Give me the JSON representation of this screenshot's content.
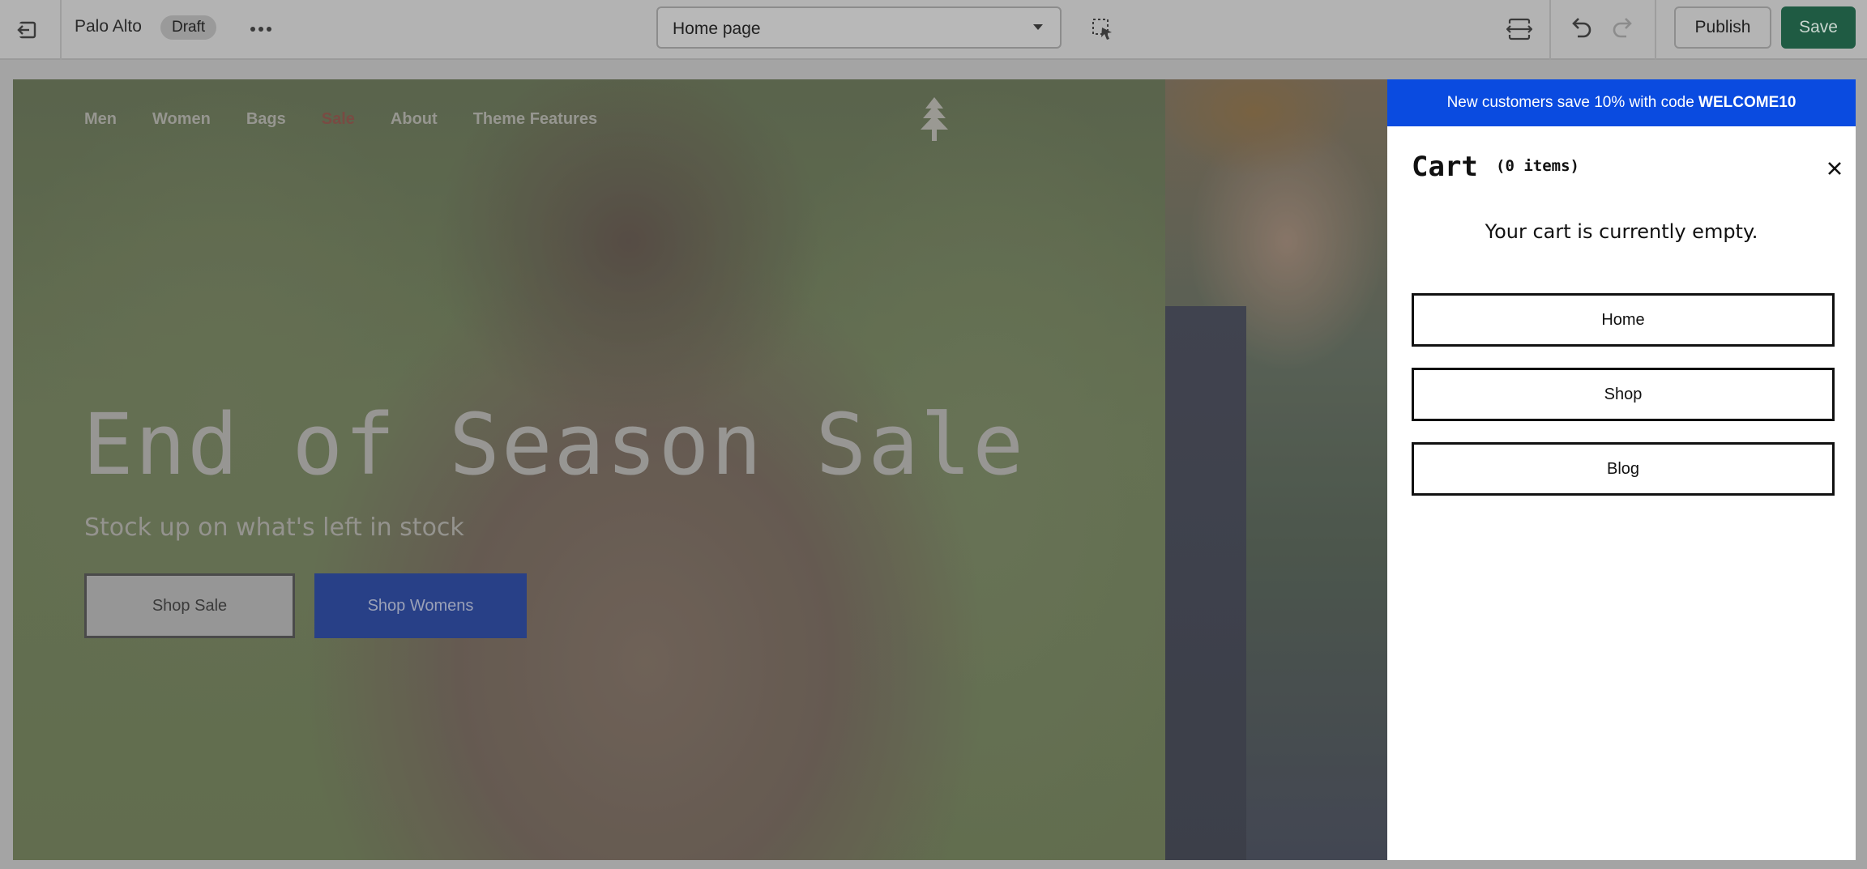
{
  "editor": {
    "store_name": "Palo Alto",
    "status_badge": "Draft",
    "page_selector": {
      "selected": "Home page"
    },
    "actions": {
      "publish": "Publish",
      "save": "Save"
    },
    "icons": {
      "exit": "exit-icon",
      "more": "more-horizontal-icon",
      "chevron": "chevron-down-icon",
      "inspector": "select-element-icon",
      "viewport": "viewport-resize-icon",
      "undo": "undo-icon",
      "redo": "redo-icon"
    },
    "colors": {
      "save_button": "#1f5b43",
      "topbar": "#b3b3b3"
    }
  },
  "preview": {
    "nav": {
      "items": [
        {
          "label": "Men"
        },
        {
          "label": "Women"
        },
        {
          "label": "Bags"
        },
        {
          "label": "Sale"
        },
        {
          "label": "About"
        },
        {
          "label": "Theme Features"
        }
      ],
      "logo_icon": "tree-logo-icon"
    },
    "hero": {
      "title": "End of Season Sale",
      "subtitle": "Stock up on what's left in stock",
      "primary_button": "Shop Sale",
      "secondary_button": "Shop Womens"
    },
    "colors": {
      "sale_link": "#7a3b30",
      "secondary_button": "#0a2c8e"
    }
  },
  "cart": {
    "promo_text": "New customers save 10% with code ",
    "promo_code": "WELCOME10",
    "title": "Cart",
    "count": "(0 items)",
    "empty_message": "Your cart is currently empty.",
    "links": [
      {
        "label": "Home"
      },
      {
        "label": "Shop"
      },
      {
        "label": "Blog"
      }
    ],
    "close_icon": "close-icon",
    "colors": {
      "promo_bar": "#0a4be0"
    }
  }
}
